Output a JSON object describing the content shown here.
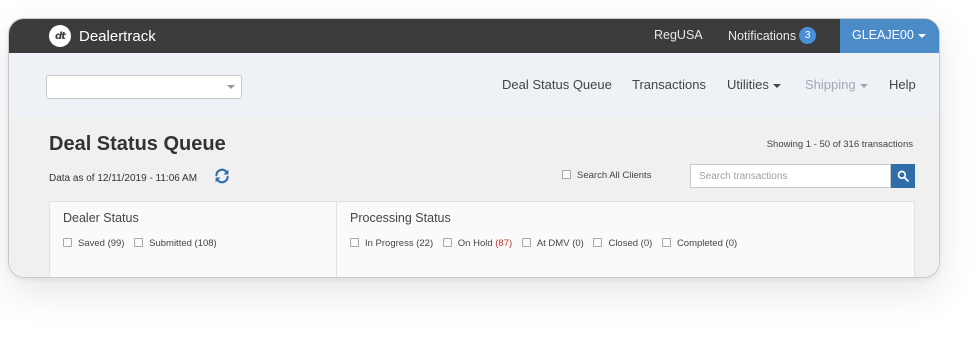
{
  "brand": {
    "logo_text": "dt",
    "name": "Dealertrack"
  },
  "topbar": {
    "regusa": "RegUSA",
    "notifications_label": "Notifications",
    "notifications_count": "3",
    "user": "GLEAJE00"
  },
  "nav": {
    "client_select_value": "",
    "items": {
      "deal_status_queue": "Deal Status Queue",
      "transactions": "Transactions",
      "utilities": "Utilities",
      "shipping": "Shipping",
      "help": "Help"
    }
  },
  "page": {
    "title": "Deal Status Queue",
    "data_as_of": "Data as of 12/11/2019 - 11:06 AM",
    "showing": "Showing 1 - 50 of 316 transactions",
    "search_all_clients": "Search All Clients",
    "search_placeholder": "Search transactions"
  },
  "filters": {
    "dealer_status": {
      "title": "Dealer Status",
      "options": [
        {
          "label": "Saved",
          "count": "(99)"
        },
        {
          "label": "Submitted",
          "count": "(108)"
        }
      ]
    },
    "processing_status": {
      "title": "Processing Status",
      "options": [
        {
          "label": "In Progress",
          "count": "(22)"
        },
        {
          "label": "On Hold",
          "count": "(87)"
        },
        {
          "label": "At DMV",
          "count": "(0)"
        },
        {
          "label": "Closed",
          "count": "(0)"
        },
        {
          "label": "Completed",
          "count": "(0)"
        }
      ]
    }
  },
  "colors": {
    "topbar": "#3c3c3c",
    "user_menu": "#4a8bc8",
    "search_button": "#2f6ea9",
    "on_hold_count": "#c0392b",
    "refresh_icon": "#2f6ea9"
  },
  "icons": [
    "dealertrack-logo-icon",
    "chevron-down-icon",
    "refresh-icon",
    "search-icon",
    "checkbox-icon"
  ]
}
